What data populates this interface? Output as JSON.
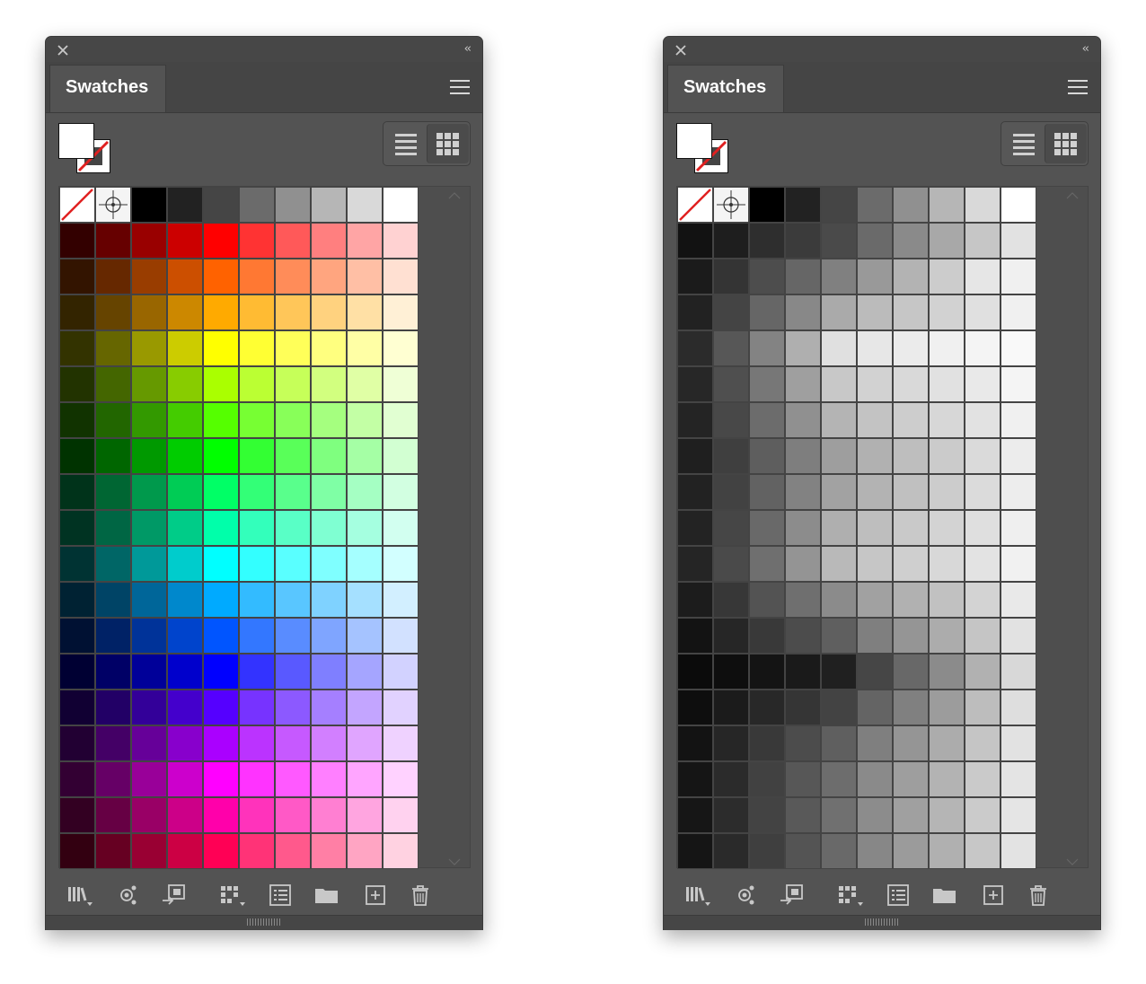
{
  "panels": [
    {
      "id": "color",
      "tab_label": "Swatches",
      "special_swatches": [
        "none-swatch",
        "registration-swatch"
      ],
      "top_row": [
        "#000000",
        "#222222",
        "#454545",
        "#6b6b6b",
        "#909090",
        "#b6b6b6",
        "#d9d9d9",
        "#ffffff"
      ],
      "rows": [
        [
          "#330000",
          "#660000",
          "#990000",
          "#cc0000",
          "#ff0000",
          "#ff3333",
          "#ff5959",
          "#ff7f7f",
          "#ffa5a5",
          "#ffd2d2"
        ],
        [
          "#331400",
          "#662800",
          "#993d00",
          "#cc4f00",
          "#ff6200",
          "#ff7833",
          "#ff8c59",
          "#ffa57f",
          "#ffbfa5",
          "#ffe0d2"
        ],
        [
          "#332400",
          "#664400",
          "#996600",
          "#cc8800",
          "#ffaa00",
          "#ffbb33",
          "#ffc659",
          "#ffd27f",
          "#ffe0a5",
          "#fff0d6"
        ],
        [
          "#333300",
          "#666600",
          "#999900",
          "#cccc00",
          "#ffff00",
          "#ffff33",
          "#ffff59",
          "#ffff7f",
          "#ffffa5",
          "#ffffd2"
        ],
        [
          "#223300",
          "#446600",
          "#669900",
          "#88cc00",
          "#aaff00",
          "#bbff33",
          "#c6ff59",
          "#d2ff7f",
          "#e0ffa5",
          "#efffd6"
        ],
        [
          "#113300",
          "#226600",
          "#339900",
          "#44cc00",
          "#55ff00",
          "#77ff33",
          "#88ff59",
          "#a5ff7f",
          "#c3ffa5",
          "#e1ffd2"
        ],
        [
          "#003300",
          "#006600",
          "#009900",
          "#00cc00",
          "#00ff00",
          "#33ff33",
          "#59ff59",
          "#7fff7f",
          "#a5ffa5",
          "#d2ffd2"
        ],
        [
          "#00331a",
          "#006633",
          "#00994c",
          "#00cc55",
          "#00ff66",
          "#33ff77",
          "#59ff8c",
          "#7fffa5",
          "#a5ffc3",
          "#d2ffe1"
        ],
        [
          "#003322",
          "#006644",
          "#009966",
          "#00cc88",
          "#00ffaa",
          "#33ffbb",
          "#59ffc6",
          "#7fffd2",
          "#a5ffe0",
          "#d2fff0"
        ],
        [
          "#003333",
          "#006666",
          "#009999",
          "#00cccc",
          "#00ffff",
          "#33ffff",
          "#59ffff",
          "#7fffff",
          "#a5ffff",
          "#d2ffff"
        ],
        [
          "#002233",
          "#004466",
          "#006699",
          "#0088cc",
          "#00aaff",
          "#33bbff",
          "#59c6ff",
          "#7fd2ff",
          "#a5e0ff",
          "#d2efff"
        ],
        [
          "#001133",
          "#002266",
          "#003399",
          "#0044cc",
          "#0055ff",
          "#3377ff",
          "#598cff",
          "#7fa5ff",
          "#a5c3ff",
          "#d2e1ff"
        ],
        [
          "#000033",
          "#000066",
          "#000099",
          "#0000cc",
          "#0000ff",
          "#3333ff",
          "#5959ff",
          "#7f7fff",
          "#a5a5ff",
          "#d2d2ff"
        ],
        [
          "#110033",
          "#220066",
          "#330099",
          "#4400cc",
          "#5500ff",
          "#7733ff",
          "#8c59ff",
          "#a57fff",
          "#c3a5ff",
          "#e1d2ff"
        ],
        [
          "#220033",
          "#440066",
          "#660099",
          "#8800cc",
          "#aa00ff",
          "#bb33ff",
          "#c659ff",
          "#d27fff",
          "#e0a5ff",
          "#efd2ff"
        ],
        [
          "#330033",
          "#660066",
          "#990099",
          "#cc00cc",
          "#ff00ff",
          "#ff33ff",
          "#ff59ff",
          "#ff7fff",
          "#ffa5ff",
          "#ffd2ff"
        ],
        [
          "#330022",
          "#660044",
          "#990066",
          "#cc0088",
          "#ff00aa",
          "#ff33bb",
          "#ff59c6",
          "#ff7fd2",
          "#ffa5e0",
          "#ffd2ef"
        ],
        [
          "#330011",
          "#660022",
          "#990033",
          "#cc0044",
          "#ff0055",
          "#ff3377",
          "#ff598c",
          "#ff7fa5",
          "#ffa5c3",
          "#ffd2e1"
        ]
      ]
    },
    {
      "id": "gray",
      "tab_label": "Swatches",
      "special_swatches": [
        "none-swatch",
        "registration-swatch"
      ],
      "top_row": [
        "#000000",
        "#222222",
        "#454545",
        "#6b6b6b",
        "#909090",
        "#b6b6b6",
        "#d9d9d9",
        "#ffffff"
      ],
      "rows": [
        [
          "#121212",
          "#1e1e1e",
          "#2e2e2e",
          "#3b3b3b",
          "#4a4a4a",
          "#6a6a6a",
          "#8a8a8a",
          "#a8a8a8",
          "#c6c6c6",
          "#e2e2e2"
        ],
        [
          "#1b1b1b",
          "#343434",
          "#4d4d4d",
          "#666666",
          "#808080",
          "#999999",
          "#b3b3b3",
          "#cccccc",
          "#e6e6e6",
          "#f0f0f0"
        ],
        [
          "#222222",
          "#444444",
          "#666666",
          "#888888",
          "#aaaaaa",
          "#bbbbbb",
          "#c6c6c6",
          "#d2d2d2",
          "#e0e0e0",
          "#f0f0f0"
        ],
        [
          "#2b2b2b",
          "#575757",
          "#838383",
          "#afafaf",
          "#e0e0e0",
          "#e7e7e7",
          "#ebebeb",
          "#f0f0f0",
          "#f4f4f4",
          "#f9f9f9"
        ],
        [
          "#272727",
          "#4f4f4f",
          "#777777",
          "#9f9f9f",
          "#c8c8c8",
          "#d2d2d2",
          "#d9d9d9",
          "#e1e1e1",
          "#e9e9e9",
          "#f4f4f4"
        ],
        [
          "#242424",
          "#484848",
          "#6c6c6c",
          "#909090",
          "#b4b4b4",
          "#c3c3c3",
          "#cdcdcd",
          "#d7d7d7",
          "#e2e2e2",
          "#f0f0f0"
        ],
        [
          "#1f1f1f",
          "#3f3f3f",
          "#5e5e5e",
          "#7e7e7e",
          "#9e9e9e",
          "#b1b1b1",
          "#bebebe",
          "#cbcbcb",
          "#dadada",
          "#ececec"
        ],
        [
          "#222222",
          "#424242",
          "#626262",
          "#828282",
          "#a2a2a2",
          "#b3b3b3",
          "#c0c0c0",
          "#cccccc",
          "#dbdbdb",
          "#ededed"
        ],
        [
          "#232323",
          "#464646",
          "#696969",
          "#8c8c8c",
          "#afafaf",
          "#bebebe",
          "#c9c9c9",
          "#d3d3d3",
          "#dfdfdf",
          "#efefef"
        ],
        [
          "#252525",
          "#4a4a4a",
          "#6f6f6f",
          "#949494",
          "#b9b9b9",
          "#c6c6c6",
          "#cfcfcf",
          "#d8d8d8",
          "#e3e3e3",
          "#f1f1f1"
        ],
        [
          "#1c1c1c",
          "#373737",
          "#535353",
          "#6f6f6f",
          "#8b8b8b",
          "#a1a1a1",
          "#b1b1b1",
          "#c1c1c1",
          "#d3d3d3",
          "#e9e9e9"
        ],
        [
          "#131313",
          "#262626",
          "#393939",
          "#4c4c4c",
          "#5f5f5f",
          "#7f7f7f",
          "#959595",
          "#acacac",
          "#c5c5c5",
          "#e2e2e2"
        ],
        [
          "#0b0b0b",
          "#0e0e0e",
          "#141414",
          "#1a1a1a",
          "#202020",
          "#464646",
          "#686868",
          "#8b8b8b",
          "#b1b1b1",
          "#d8d8d8"
        ],
        [
          "#0e0e0e",
          "#1b1b1b",
          "#282828",
          "#353535",
          "#434343",
          "#646464",
          "#808080",
          "#9c9c9c",
          "#bdbdbd",
          "#dedede"
        ],
        [
          "#131313",
          "#262626",
          "#393939",
          "#4c4c4c",
          "#5f5f5f",
          "#7f7f7f",
          "#959595",
          "#acacac",
          "#c5c5c5",
          "#e2e2e2"
        ],
        [
          "#151515",
          "#2b2b2b",
          "#414141",
          "#575757",
          "#6d6d6d",
          "#8a8a8a",
          "#9e9e9e",
          "#b3b3b3",
          "#cacaca",
          "#e4e4e4"
        ],
        [
          "#161616",
          "#2c2c2c",
          "#434343",
          "#595959",
          "#707070",
          "#8c8c8c",
          "#a0a0a0",
          "#b5b5b5",
          "#cbcbcb",
          "#e5e5e5"
        ],
        [
          "#151515",
          "#2a2a2a",
          "#3f3f3f",
          "#545454",
          "#696969",
          "#878787",
          "#9b9b9b",
          "#b0b0b0",
          "#c7c7c7",
          "#e3e3e3"
        ]
      ]
    }
  ],
  "icons": {
    "close": "close-icon",
    "collapse": "collapse-panels-icon",
    "menu": "panel-menu-icon",
    "list_view": "list-view-icon",
    "grid_view": "thumbnail-view-icon",
    "bottom_toolbar": [
      "swatch-libraries-icon",
      "show-swatch-kinds-icon",
      "swatch-options-icon",
      "color-group-icon",
      "swatch-list-icon",
      "new-folder-icon",
      "new-swatch-icon",
      "delete-swatch-icon"
    ]
  },
  "colors": {
    "panel_bg": "#535353",
    "tab_bg": "#454545",
    "titlebar_bg": "#474747",
    "icon_gray": "#c8c8c8",
    "none_slash": "#e02020"
  }
}
